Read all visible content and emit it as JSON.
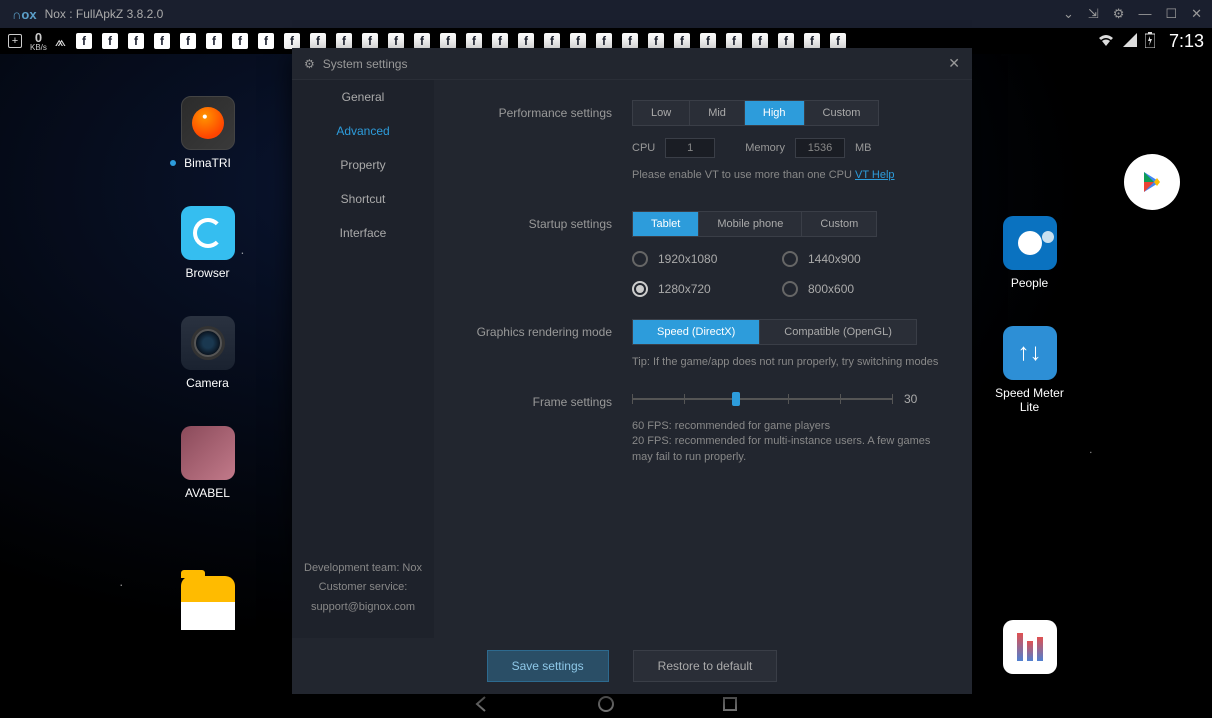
{
  "titlebar": {
    "brand": "NOX",
    "title": "Nox : FullApkZ 3.8.2.0"
  },
  "androidbar": {
    "speed_value": "0",
    "speed_unit": "KB/s",
    "clock": "7:13"
  },
  "desk": {
    "bimatri": "BimaTRI",
    "browser": "Browser",
    "camera": "Camera",
    "avabel": "AVABEL",
    "people": "People",
    "speedmeter": "Speed Meter Lite"
  },
  "dialog": {
    "title": "System settings",
    "sidebar": {
      "general": "General",
      "advanced": "Advanced",
      "property": "Property",
      "shortcut": "Shortcut",
      "interface": "Interface"
    },
    "footer": {
      "team": "Development team: Nox",
      "service": "Customer service:",
      "email": "support@bignox.com"
    },
    "perf": {
      "label": "Performance settings",
      "low": "Low",
      "mid": "Mid",
      "high": "High",
      "custom": "Custom",
      "cpu_label": "CPU",
      "cpu_value": "1",
      "mem_label": "Memory",
      "mem_value": "1536",
      "mem_unit": "MB",
      "vt_hint": "Please enable VT to use more than one CPU ",
      "vt_link": "VT Help"
    },
    "startup": {
      "label": "Startup settings",
      "tablet": "Tablet",
      "mobile": "Mobile phone",
      "custom": "Custom",
      "res1": "1920x1080",
      "res2": "1440x900",
      "res3": "1280x720",
      "res4": "800x600"
    },
    "render": {
      "label": "Graphics rendering mode",
      "speed": "Speed (DirectX)",
      "compat": "Compatible (OpenGL)",
      "hint": "Tip: If the game/app does not run properly, try switching modes"
    },
    "frame": {
      "label": "Frame settings",
      "value": "30",
      "hint1": "60 FPS: recommended for game players",
      "hint2": "20 FPS: recommended for multi-instance users. A few games may fail to run properly."
    },
    "buttons": {
      "save": "Save settings",
      "restore": "Restore to default"
    }
  }
}
